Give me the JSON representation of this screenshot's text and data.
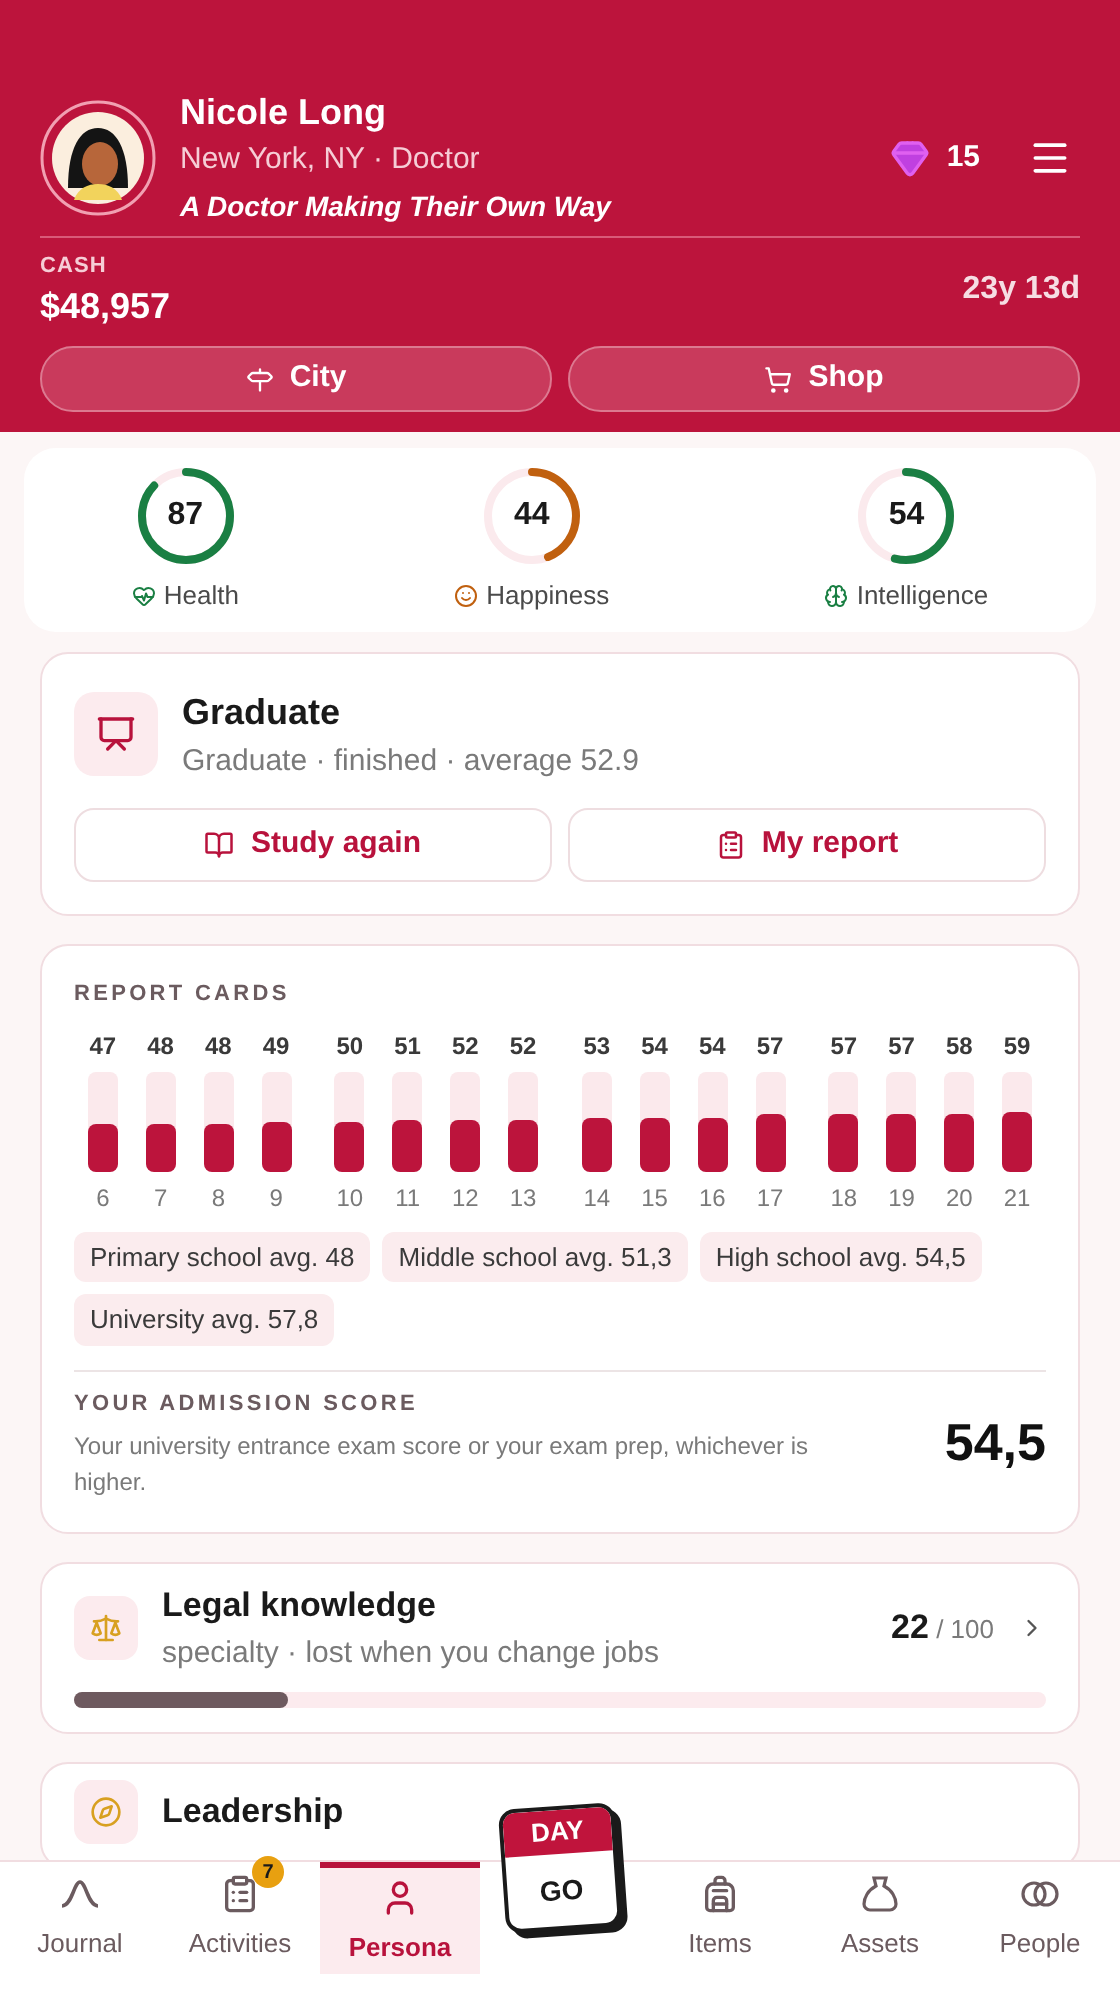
{
  "profile": {
    "name": "Nicole Long",
    "subtitle": "New York, NY · Doctor",
    "tagline": "A Doctor Making Their Own Way",
    "gems": "15",
    "cash_label": "CASH",
    "cash": "$48,957",
    "age": "23y 13d"
  },
  "header_buttons": [
    {
      "kind": "city",
      "label": "City"
    },
    {
      "kind": "shop",
      "label": "Shop"
    }
  ],
  "stats": [
    {
      "kind": "health",
      "value": "87",
      "label": "Health",
      "level": 0.87,
      "color": "#1a7f43"
    },
    {
      "kind": "happiness",
      "value": "44",
      "label": "Happiness",
      "level": 0.44,
      "color": "#c0600f"
    },
    {
      "kind": "intelligence",
      "value": "54",
      "label": "Intelligence",
      "level": 0.54,
      "color": "#1a7f43"
    }
  ],
  "education": {
    "title": "Graduate",
    "subtitle": "Graduate · finished · average 52.9",
    "buttons": [
      {
        "kind": "study",
        "label": "Study again"
      },
      {
        "kind": "report",
        "label": "My report"
      }
    ]
  },
  "report_cards": {
    "title": "REPORT CARDS",
    "chart_data": {
      "type": "bar",
      "categories": [
        "6",
        "7",
        "8",
        "9",
        "10",
        "11",
        "12",
        "13",
        "14",
        "15",
        "16",
        "17",
        "18",
        "19",
        "20",
        "21"
      ],
      "values": [
        47,
        48,
        48,
        49,
        50,
        51,
        52,
        52,
        53,
        54,
        54,
        57,
        57,
        57,
        58,
        59
      ],
      "ylim": [
        0,
        100
      ],
      "data_labels": true
    },
    "averages": [
      "Primary school avg. 48",
      "Middle school avg. 51,3",
      "High school avg. 54,5",
      "University avg. 57,8"
    ],
    "admission_title": "YOUR ADMISSION SCORE",
    "admission_text": "Your university entrance exam score or your exam prep, whichever is higher.",
    "admission_score": "54,5"
  },
  "skills": [
    {
      "kind": "legal",
      "title": "Legal knowledge",
      "subtitle": "specialty · lost when you change jobs",
      "value": "22",
      "total": "/ 100",
      "level": 0.22
    },
    {
      "kind": "leadership",
      "title": "Leadership"
    }
  ],
  "nav": [
    {
      "kind": "journal",
      "label": "Journal",
      "selected": false
    },
    {
      "kind": "activities",
      "label": "Activities",
      "selected": false,
      "badge": "7"
    },
    {
      "kind": "persona",
      "label": "Persona",
      "selected": true
    },
    {
      "kind": "day",
      "top": "DAY",
      "bottom": "GO",
      "selected": false
    },
    {
      "kind": "items",
      "label": "Items",
      "selected": false
    },
    {
      "kind": "assets",
      "label": "Assets",
      "selected": false
    },
    {
      "kind": "people",
      "label": "People",
      "selected": false
    }
  ]
}
